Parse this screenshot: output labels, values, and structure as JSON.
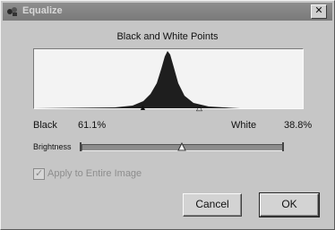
{
  "window": {
    "title": "Equalize",
    "close_label": "✕"
  },
  "group_title": "Black and White Points",
  "histogram": {
    "black_marker": "▲",
    "white_marker": "△"
  },
  "black": {
    "label": "Black",
    "value": "61.1%"
  },
  "white": {
    "label": "White",
    "value": "38.8%"
  },
  "brightness": {
    "label": "Brightness",
    "level": 0.48
  },
  "apply_checkbox": {
    "label": "Apply to Entire Image",
    "checked": true
  },
  "buttons": {
    "cancel": "Cancel",
    "ok": "OK"
  }
}
